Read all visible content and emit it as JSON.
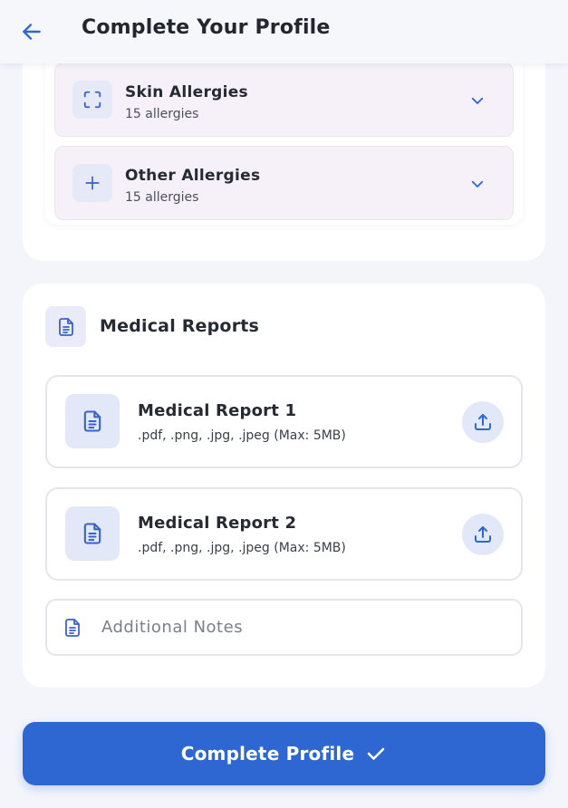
{
  "header": {
    "title": "Complete Your Profile",
    "back_icon": "arrow-left-icon"
  },
  "allergies": {
    "items": [
      {
        "name": "Skin Allergies",
        "count": "15 allergies",
        "icon": "scan-icon"
      },
      {
        "name": "Other Allergies",
        "count": "15 allergies",
        "icon": "plus-icon"
      }
    ]
  },
  "medical_reports": {
    "title": "Medical Reports",
    "icon": "document-icon",
    "reports": [
      {
        "name": "Medical Report 1",
        "hint": ".pdf, .png, .jpg, .jpeg (Max: 5MB)"
      },
      {
        "name": "Medical Report 2",
        "hint": ".pdf, .png, .jpg, .jpeg (Max: 5MB)"
      }
    ],
    "notes": {
      "placeholder": "Additional Notes",
      "value": ""
    }
  },
  "footer": {
    "complete_label": "Complete Profile",
    "complete_icon": "check-icon"
  },
  "colors": {
    "primary": "#2f67d2",
    "icon_bg": "#e3e8f8",
    "allergy_bg": "#f6f1f8"
  }
}
